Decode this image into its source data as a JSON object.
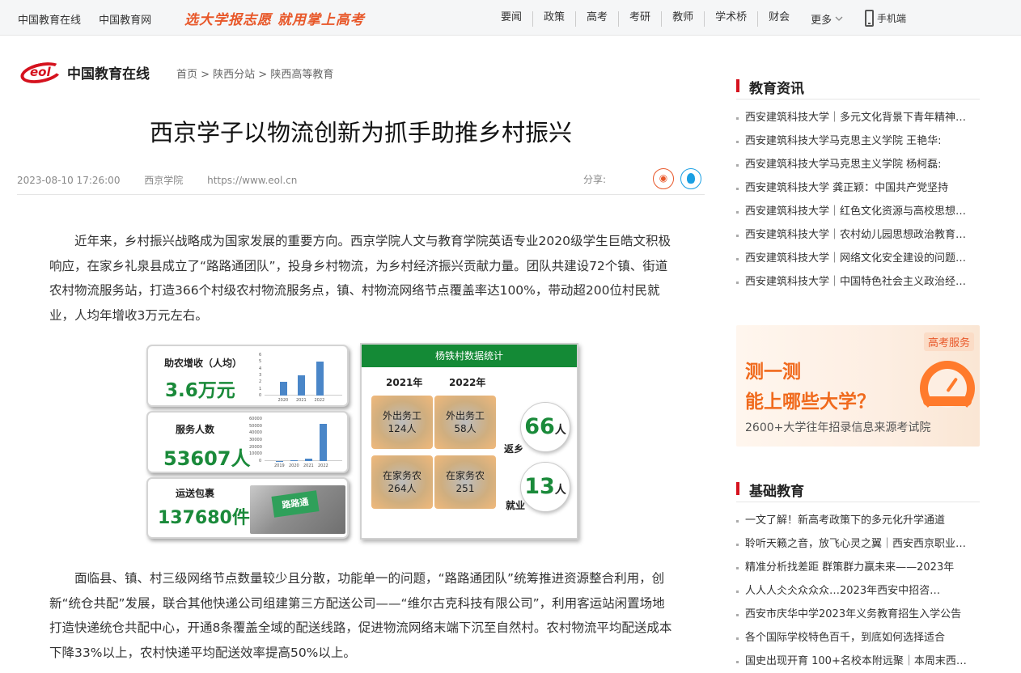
{
  "topbar": {
    "sites": [
      "中国教育在线",
      "中国教育网"
    ],
    "slogan": "选大学报志愿 就用掌上高考",
    "nav": [
      "要闻",
      "政策",
      "高考",
      "考研",
      "教师",
      "学术桥",
      "财会"
    ],
    "more": "更多",
    "mobile": "手机端"
  },
  "logo": {
    "mark": "eol",
    "name": "中国教育在线"
  },
  "breadcrumb": "首页 > 陕西分站 > 陕西高等教育",
  "article": {
    "title": "西京学子以物流创新为抓手助推乡村振兴",
    "date": "2023-08-10 17:26:00",
    "source": "西京学院",
    "url": "https://www.eol.cn",
    "share_label": "分享:",
    "para1": "近年来，乡村振兴战略成为国家发展的重要方向。西京学院人文与教育学院英语专业2020级学生巨皓文积极响应，在家乡礼泉县成立了“路路通团队”，投身乡村物流，为乡村经济振兴贡献力量。团队共建设72个镇、街道农村物流服务站，打造366个村级农村物流服务点，镇、村物流网络节点覆盖率达100%，带动超200位村民就业，人均年增收3万元左右。",
    "para2": "面临县、镇、村三级网络节点数量较少且分散，功能单一的问题，“路路通团队”统筹推进资源整合利用，创新“统仓共配”发展，联合其他快递公司组建第三方配送公司——“维尔古克科技有限公司”，利用客运站闲置场地打造快递统仓共配中心，开通8条覆盖全域的配送线路，促进物流网络末端下沉至自然村。农村物流平均配送成本下降33%以上，农村快递平均配送效率提高50%以上。"
  },
  "infographic": {
    "card1": {
      "label": "助农增收（人均）",
      "value": "3.6万元",
      "chart": {
        "ticks": [
          "6",
          "5",
          "4",
          "3",
          "2",
          "1",
          "0"
        ],
        "x": [
          "2020",
          "2021",
          "2022"
        ],
        "values": [
          2,
          3,
          5
        ],
        "ymax": 6
      }
    },
    "card2": {
      "label": "服务人数",
      "value": "53607人",
      "chart": {
        "ticks": [
          "60000",
          "50000",
          "40000",
          "30000",
          "20000",
          "10000",
          "0"
        ],
        "x": [
          "2019",
          "2020",
          "2021",
          "2022"
        ],
        "values": [
          200,
          800,
          3000,
          53607
        ],
        "ymax": 60000
      }
    },
    "card3": {
      "label": "运送包裹",
      "value": "137680件",
      "photo_text": "路路通"
    },
    "stat": {
      "title": "杨铁村数据统计",
      "year1": "2021年",
      "year2": "2022年",
      "q1": "外出务工",
      "q1v": "124人",
      "q2": "外出务工",
      "q2v": "58人",
      "q3": "在家务农",
      "q3v": "264人",
      "q4": "在家务农",
      "q4v": "251",
      "b1": "66",
      "b1u": "人",
      "b1tag": "返乡",
      "b2": "13",
      "b2u": "人",
      "b2tag": "就业"
    }
  },
  "sidebar": {
    "section1": {
      "title": "教育资讯",
      "items": [
        "西安建筑科技大学｜多元文化背景下青年精神…",
        "西安建筑科技大学马克思主义学院 王艳华:",
        "西安建筑科技大学马克思主义学院 杨柯磊:",
        "西安建筑科技大学 龚正颖：中国共产党坚持",
        "西安建筑科技大学｜红色文化资源与高校思想…",
        "西安建筑科技大学｜农村幼儿园思想政治教育…",
        "西安建筑科技大学｜网络文化安全建设的问题…",
        "西安建筑科技大学｜中国特色社会主义政治经…"
      ]
    },
    "ad": {
      "badge": "高考服务",
      "line1": "测一测",
      "line2": "能上哪些大学？",
      "sub": "2600+大学往年招录信息来源考试院"
    },
    "section2": {
      "title": "基础教育",
      "items": [
        "一文了解！新高考政策下的多元化升学通道",
        "聆听天籁之音，放飞心灵之翼｜西安西京职业…",
        "精准分析找差距 群策群力赢未来——2023年",
        "人人人仌仌众众众…2023年西安中招咨…",
        "西安市庆华中学2023年义务教育招生入学公告",
        "各个国际学校特色百千，到底如何选择适合",
        "国史出现开育 100+名校本附远聚｜本周末西…"
      ]
    }
  }
}
